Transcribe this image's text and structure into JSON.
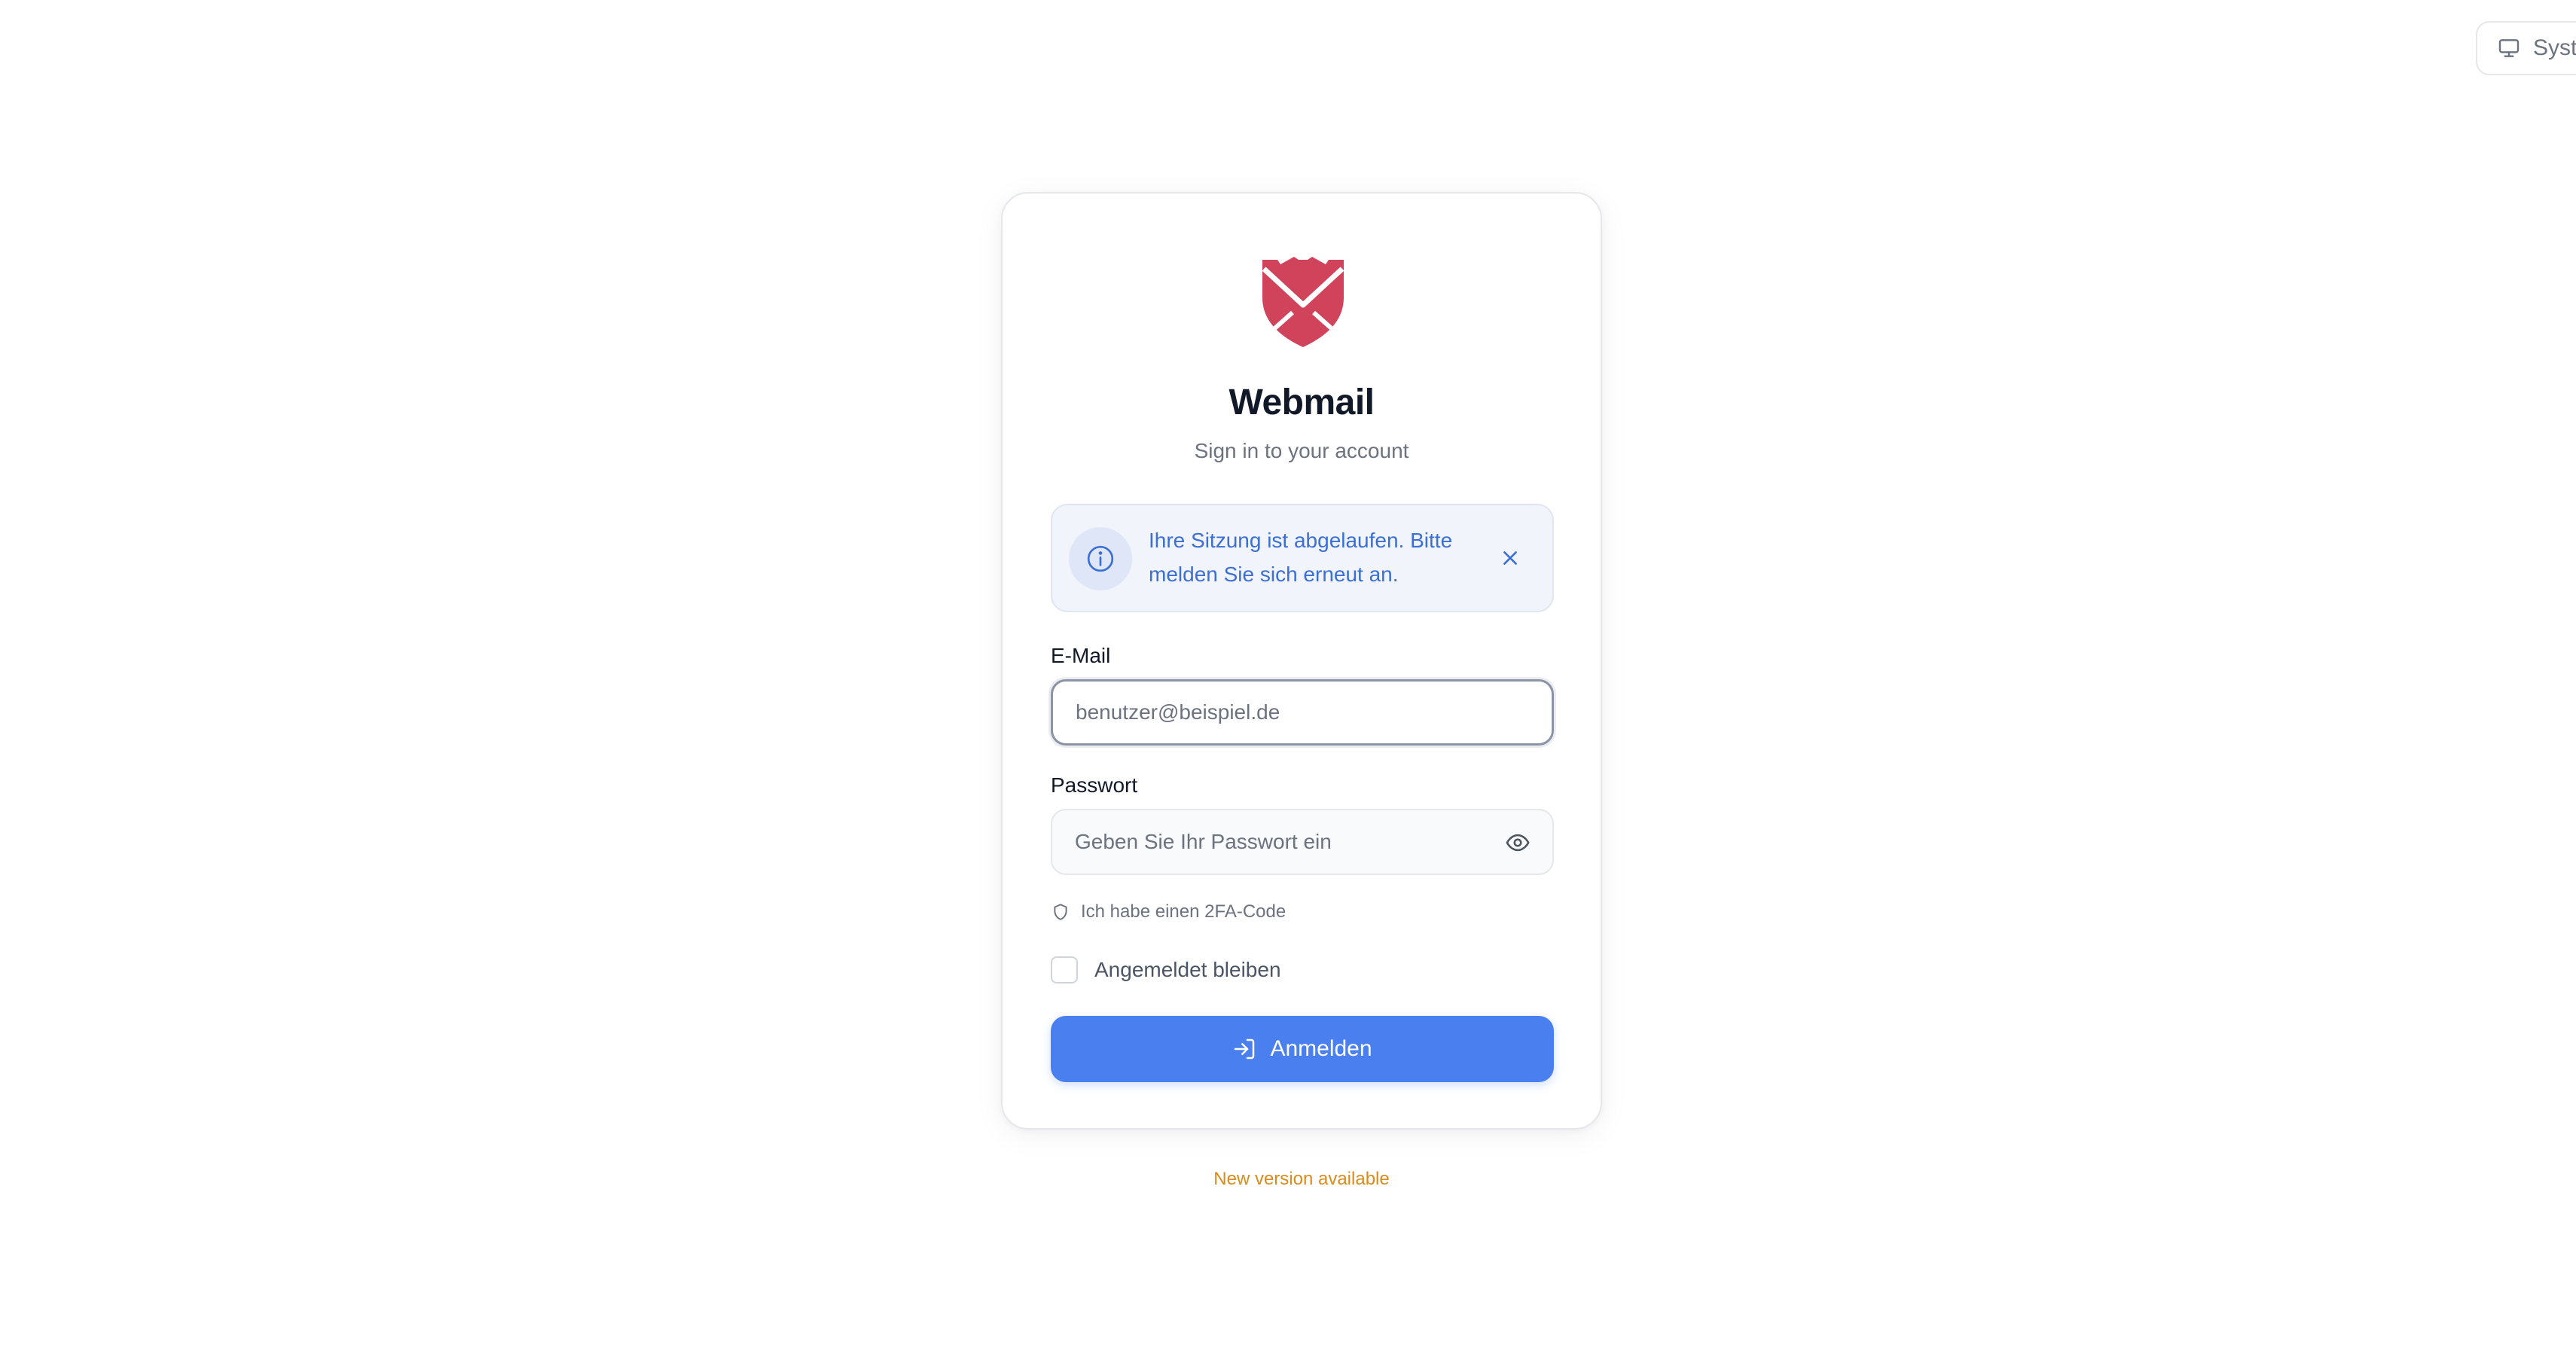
{
  "theme_toggle": {
    "label": "System",
    "icon": "monitor-icon"
  },
  "brand": {
    "title": "Webmail",
    "subtitle": "Sign in to your account",
    "logo": "shield-envelope-logo",
    "color": "#d0435b"
  },
  "alert": {
    "icon": "info-icon",
    "message": "Ihre Sitzung ist abgelaufen. Bitte melden Sie sich erneut an.",
    "close_icon": "close-icon",
    "color": "#3b6fd4"
  },
  "form": {
    "email_label": "E-Mail",
    "email_placeholder": "benutzer@beispiel.de",
    "password_label": "Passwort",
    "password_placeholder": "Geben Sie Ihr Passwort ein",
    "password_toggle_icon": "eye-icon",
    "tfa_label": "Ich habe einen 2FA-Code",
    "tfa_icon": "shield-icon",
    "remember_label": "Angemeldet bleiben",
    "submit_label": "Anmelden",
    "submit_icon": "sign-in-icon",
    "accent_color": "#4a7ff0"
  },
  "footer": {
    "new_version": "New version available",
    "color": "#d98c1a"
  }
}
